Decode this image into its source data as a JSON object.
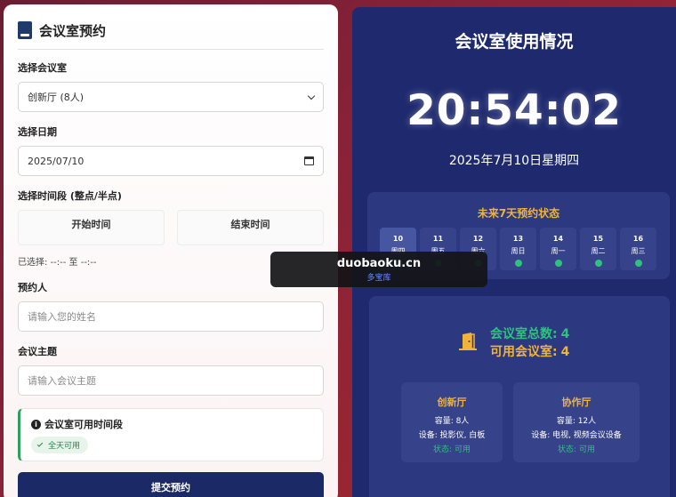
{
  "form": {
    "title": "会议室预约",
    "room_label": "选择会议室",
    "room_value": "创新厅 (8人)",
    "date_label": "选择日期",
    "date_value": "2025/07/10",
    "time_label": "选择时间段 (整点/半点)",
    "start_label": "开始时间",
    "end_label": "结束时间",
    "selected_text": "已选择: --:-- 至 --:--",
    "name_label": "预约人",
    "name_placeholder": "请输入您的姓名",
    "topic_label": "会议主题",
    "topic_placeholder": "请输入会议主题",
    "availability_title": "会议室可用时间段",
    "availability_badge": "全天可用",
    "submit_label": "提交预约"
  },
  "dashboard": {
    "title": "会议室使用情况",
    "clock": "20:54:02",
    "date_line": "2025年7月10日星期四",
    "week_title": "未来7天预约状态",
    "days": [
      {
        "num": "10",
        "weekday": "周四"
      },
      {
        "num": "11",
        "weekday": "周五"
      },
      {
        "num": "12",
        "weekday": "周六"
      },
      {
        "num": "13",
        "weekday": "周日"
      },
      {
        "num": "14",
        "weekday": "周一"
      },
      {
        "num": "15",
        "weekday": "周二"
      },
      {
        "num": "16",
        "weekday": "周三"
      }
    ],
    "total_label": "会议室总数:",
    "total_value": "4",
    "available_label": "可用会议室:",
    "available_value": "4",
    "rooms": [
      {
        "name": "创新厅",
        "capacity": "容量: 8人",
        "devices": "设备: 投影仪, 白板",
        "status": "状态: 可用"
      },
      {
        "name": "协作厅",
        "capacity": "容量: 12人",
        "devices": "设备: 电视, 视频会议设备",
        "status": "状态: 可用"
      }
    ]
  },
  "watermark": {
    "domain": "duobaoku.cn",
    "name": "多宝库"
  },
  "colors": {
    "primary": "#1b2a66",
    "accent": "#f0b43a",
    "success": "#2ec27e",
    "dashboard_bg": "#1f2a6e"
  }
}
